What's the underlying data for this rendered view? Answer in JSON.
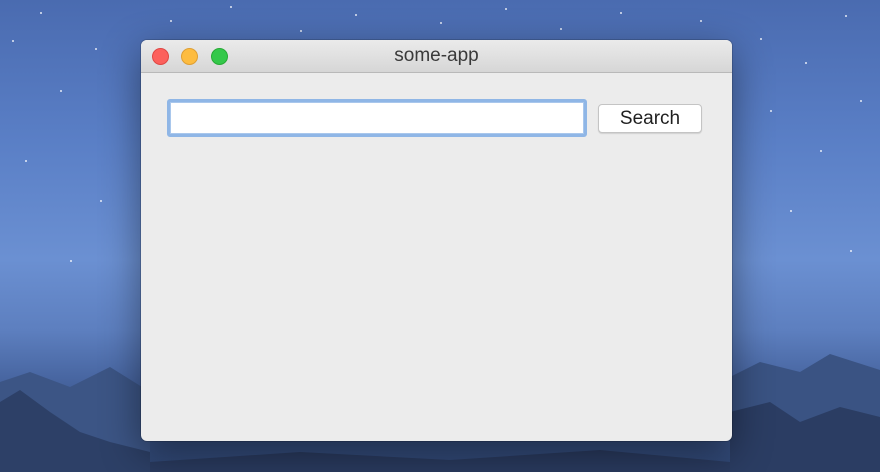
{
  "window": {
    "title": "some-app"
  },
  "search": {
    "value": "",
    "placeholder": "",
    "button_label": "Search"
  },
  "colors": {
    "close": "#fc605c",
    "minimize": "#fdbc40",
    "zoom": "#34c84a",
    "focus_ring": "#8fb6e6"
  },
  "icons": [
    "close-button",
    "minimize-button",
    "zoom-button"
  ]
}
